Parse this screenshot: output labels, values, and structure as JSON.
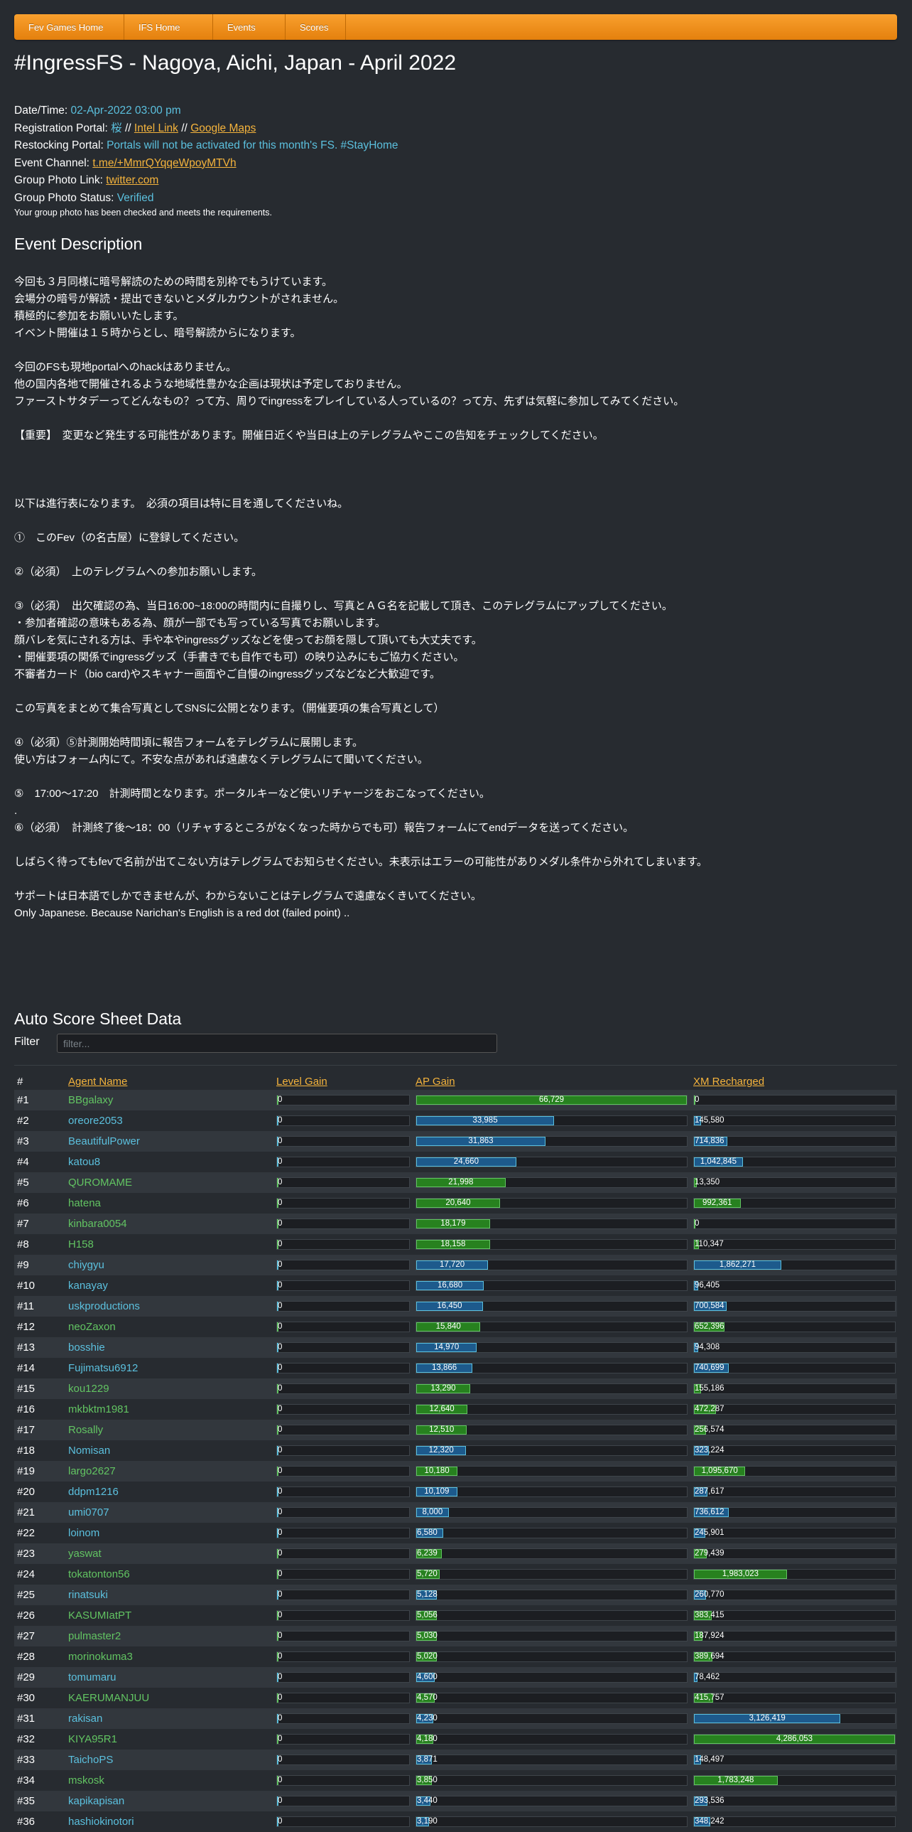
{
  "nav": [
    "Fev Games Home",
    "IFS Home",
    "Events",
    "Scores"
  ],
  "title": "#IngressFS - Nagoya, Aichi, Japan - April 2022",
  "info": {
    "datetime_label": "Date/Time:",
    "datetime": "02-Apr-2022 03:00 pm",
    "reg_label": "Registration Portal:",
    "reg_portal": "桜",
    "sep": "//",
    "intel_link": "Intel Link",
    "google_maps": "Google Maps",
    "restock_label": "Restocking Portal:",
    "restock": "Portals will not be activated for this month's FS. #StayHome",
    "channel_label": "Event Channel:",
    "channel": "t.me/+MmrQYqqeWpoyMTVh",
    "photo_link_label": "Group Photo Link:",
    "photo_link": "twitter.com",
    "photo_status_label": "Group Photo Status:",
    "photo_status": "Verified",
    "photo_note": "Your group photo has been checked and meets the requirements."
  },
  "event_description_heading": "Event Description",
  "description": "今回も３月同様に暗号解読のための時間を別枠でもうけています。\n会場分の暗号が解読・提出できないとメダルカウントがされません。\n積極的に参加をお願いいたします。\nイベント開催は１５時からとし、暗号解読からになります。\n\n今回のFSも現地portalへのhackはありません。\n他の国内各地で開催されるような地域性豊かな企画は現状は予定しておりません。\nファーストサタデーってどんなもの？って方、周りでingressをプレイしている人っているの？って方、先ずは気軽に参加してみてください。\n\n【重要】　変更など発生する可能性があります。開催日近くや当日は上のテレグラムやここの告知をチェックしてください。\n\n\n\n以下は進行表になります。　必須の項目は特に目を通してくださいね。\n\n①　このFev（の名古屋）に登録してください。\n\n②（必須）　上のテレグラムへの参加お願いします。\n\n③（必須）　出欠確認の為、当日16:00~18:00の時間内に自撮りし、写真とＡＧ名を記載して頂き、このテレグラムにアップしてください。\n・参加者確認の意味もある為、顔が一部でも写っている写真でお願いします。\n顔バレを気にされる方は、手や本やingressグッズなどを使ってお顔を隠して頂いても大丈夫です。\n・開催要項の関係でingressグッズ（手書きでも自作でも可）の映り込みにもご協力ください。\n不審者カード（bio card)やスキャナー画面やご自慢のingressグッズなどなど大歓迎です。\n\nこの写真をまとめて集合写真としてSNSに公開となります。（開催要項の集合写真として）\n\n④（必須）⑤計測開始時間頃に報告フォームをテレグラムに展開します。\n使い方はフォーム内にて。不安な点があれば遠慮なくテレグラムにて聞いてください。\n\n⑤　17:00～17:20　計測時間となります。ポータルキーなど使いリチャージをおこなってください。\n.\n⑥（必須）　計測終了後～18：00（リチャするところがなくなった時からでも可）報告フォームにてendデータを送ってください。\n\nしばらく待ってもfevで名前が出てこない方はテレグラムでお知らせください。未表示はエラーの可能性がありメダル条件から外れてしまいます。\n\nサポートは日本語でしかできませんが、わからないことはテレグラムで遠慮なくきいてください。\nOnly Japanese. Because Narichan's English is a red dot (failed point) ..",
  "score_heading": "Auto Score Sheet Data",
  "filter": {
    "label": "Filter",
    "placeholder": "filter..."
  },
  "table": {
    "headers": [
      "#",
      "Agent Name",
      "Level Gain",
      "AP Gain",
      "XM Recharged"
    ],
    "max_ap": 66729,
    "max_xm": 4286053,
    "rows": [
      {
        "rank": "#1",
        "name": "BBgalaxy",
        "team": "g",
        "level": "0",
        "ap": 66729,
        "ap_text": "66,729",
        "xm": 0,
        "xm_text": "0"
      },
      {
        "rank": "#2",
        "name": "oreore2053",
        "team": "b",
        "level": "0",
        "ap": 33985,
        "ap_text": "33,985",
        "xm": 145580,
        "xm_text": "145,580"
      },
      {
        "rank": "#3",
        "name": "BeautifulPower",
        "team": "b",
        "level": "0",
        "ap": 31863,
        "ap_text": "31,863",
        "xm": 714836,
        "xm_text": "714,836"
      },
      {
        "rank": "#4",
        "name": "katou8",
        "team": "b",
        "level": "0",
        "ap": 24660,
        "ap_text": "24,660",
        "xm": 1042845,
        "xm_text": "1,042,845"
      },
      {
        "rank": "#5",
        "name": "QUROMAME",
        "team": "g",
        "level": "0",
        "ap": 21998,
        "ap_text": "21,998",
        "xm": 13350,
        "xm_text": "13,350"
      },
      {
        "rank": "#6",
        "name": "hatena",
        "team": "g",
        "level": "0",
        "ap": 20640,
        "ap_text": "20,640",
        "xm": 992361,
        "xm_text": "992,361"
      },
      {
        "rank": "#7",
        "name": "kinbara0054",
        "team": "g",
        "level": "0",
        "ap": 18179,
        "ap_text": "18,179",
        "xm": 0,
        "xm_text": "0"
      },
      {
        "rank": "#8",
        "name": "H158",
        "team": "g",
        "level": "0",
        "ap": 18158,
        "ap_text": "18,158",
        "xm": 110347,
        "xm_text": "110,347"
      },
      {
        "rank": "#9",
        "name": "chiygyu",
        "team": "b",
        "level": "0",
        "ap": 17720,
        "ap_text": "17,720",
        "xm": 1862271,
        "xm_text": "1,862,271"
      },
      {
        "rank": "#10",
        "name": "kanayay",
        "team": "b",
        "level": "0",
        "ap": 16680,
        "ap_text": "16,680",
        "xm": 96405,
        "xm_text": "96,405"
      },
      {
        "rank": "#11",
        "name": "uskproductions",
        "team": "b",
        "level": "0",
        "ap": 16450,
        "ap_text": "16,450",
        "xm": 700584,
        "xm_text": "700,584"
      },
      {
        "rank": "#12",
        "name": "neoZaxon",
        "team": "g",
        "level": "0",
        "ap": 15840,
        "ap_text": "15,840",
        "xm": 652396,
        "xm_text": "652,396"
      },
      {
        "rank": "#13",
        "name": "bosshie",
        "team": "b",
        "level": "0",
        "ap": 14970,
        "ap_text": "14,970",
        "xm": 94308,
        "xm_text": "94,308"
      },
      {
        "rank": "#14",
        "name": "Fujimatsu6912",
        "team": "b",
        "level": "0",
        "ap": 13866,
        "ap_text": "13,866",
        "xm": 740699,
        "xm_text": "740,699"
      },
      {
        "rank": "#15",
        "name": "kou1229",
        "team": "g",
        "level": "0",
        "ap": 13290,
        "ap_text": "13,290",
        "xm": 155186,
        "xm_text": "155,186"
      },
      {
        "rank": "#16",
        "name": "mkbktm1981",
        "team": "g",
        "level": "0",
        "ap": 12640,
        "ap_text": "12,640",
        "xm": 472287,
        "xm_text": "472,287"
      },
      {
        "rank": "#17",
        "name": "Rosally",
        "team": "g",
        "level": "0",
        "ap": 12510,
        "ap_text": "12,510",
        "xm": 256574,
        "xm_text": "256,574"
      },
      {
        "rank": "#18",
        "name": "Nomisan",
        "team": "b",
        "level": "0",
        "ap": 12320,
        "ap_text": "12,320",
        "xm": 323224,
        "xm_text": "323,224"
      },
      {
        "rank": "#19",
        "name": "largo2627",
        "team": "g",
        "level": "0",
        "ap": 10180,
        "ap_text": "10,180",
        "xm": 1095670,
        "xm_text": "1,095,670"
      },
      {
        "rank": "#20",
        "name": "ddpm1216",
        "team": "b",
        "level": "0",
        "ap": 10109,
        "ap_text": "10,109",
        "xm": 287617,
        "xm_text": "287,617"
      },
      {
        "rank": "#21",
        "name": "umi0707",
        "team": "b",
        "level": "0",
        "ap": 8000,
        "ap_text": "8,000",
        "xm": 736612,
        "xm_text": "736,612"
      },
      {
        "rank": "#22",
        "name": "loinom",
        "team": "b",
        "level": "0",
        "ap": 6580,
        "ap_text": "6,580",
        "xm": 245901,
        "xm_text": "245,901"
      },
      {
        "rank": "#23",
        "name": "yaswat",
        "team": "g",
        "level": "0",
        "ap": 6239,
        "ap_text": "6,239",
        "xm": 279439,
        "xm_text": "279,439"
      },
      {
        "rank": "#24",
        "name": "tokatonton56",
        "team": "g",
        "level": "0",
        "ap": 5720,
        "ap_text": "5,720",
        "xm": 1983023,
        "xm_text": "1,983,023"
      },
      {
        "rank": "#25",
        "name": "rinatsuki",
        "team": "b",
        "level": "0",
        "ap": 5128,
        "ap_text": "5,128",
        "xm": 260770,
        "xm_text": "260,770"
      },
      {
        "rank": "#26",
        "name": "KASUMIatPT",
        "team": "g",
        "level": "0",
        "ap": 5056,
        "ap_text": "5,056",
        "xm": 383415,
        "xm_text": "383,415"
      },
      {
        "rank": "#27",
        "name": "pulmaster2",
        "team": "g",
        "level": "0",
        "ap": 5030,
        "ap_text": "5,030",
        "xm": 187924,
        "xm_text": "187,924"
      },
      {
        "rank": "#28",
        "name": "morinokuma3",
        "team": "g",
        "level": "0",
        "ap": 5020,
        "ap_text": "5,020",
        "xm": 389694,
        "xm_text": "389,694"
      },
      {
        "rank": "#29",
        "name": "tomumaru",
        "team": "b",
        "level": "0",
        "ap": 4600,
        "ap_text": "4,600",
        "xm": 78462,
        "xm_text": "78,462"
      },
      {
        "rank": "#30",
        "name": "KAERUMANJUU",
        "team": "g",
        "level": "0",
        "ap": 4570,
        "ap_text": "4,570",
        "xm": 415757,
        "xm_text": "415,757"
      },
      {
        "rank": "#31",
        "name": "rakisan",
        "team": "b",
        "level": "0",
        "ap": 4230,
        "ap_text": "4,230",
        "xm": 3126419,
        "xm_text": "3,126,419"
      },
      {
        "rank": "#32",
        "name": "KIYA95R1",
        "team": "g",
        "level": "0",
        "ap": 4180,
        "ap_text": "4,180",
        "xm": 4286053,
        "xm_text": "4,286,053"
      },
      {
        "rank": "#33",
        "name": "TaichoPS",
        "team": "b",
        "level": "0",
        "ap": 3871,
        "ap_text": "3,871",
        "xm": 148497,
        "xm_text": "148,497"
      },
      {
        "rank": "#34",
        "name": "mskosk",
        "team": "g",
        "level": "0",
        "ap": 3850,
        "ap_text": "3,850",
        "xm": 1783248,
        "xm_text": "1,783,248"
      },
      {
        "rank": "#35",
        "name": "kapikapisan",
        "team": "b",
        "level": "0",
        "ap": 3440,
        "ap_text": "3,440",
        "xm": 293536,
        "xm_text": "293,536"
      },
      {
        "rank": "#36",
        "name": "hashiokinotori",
        "team": "b",
        "level": "0",
        "ap": 3190,
        "ap_text": "3,190",
        "xm": 348242,
        "xm_text": "348,242"
      }
    ]
  },
  "colors": {
    "green": "#62c462",
    "blue": "#5bc0de",
    "accent": "#f89406"
  }
}
